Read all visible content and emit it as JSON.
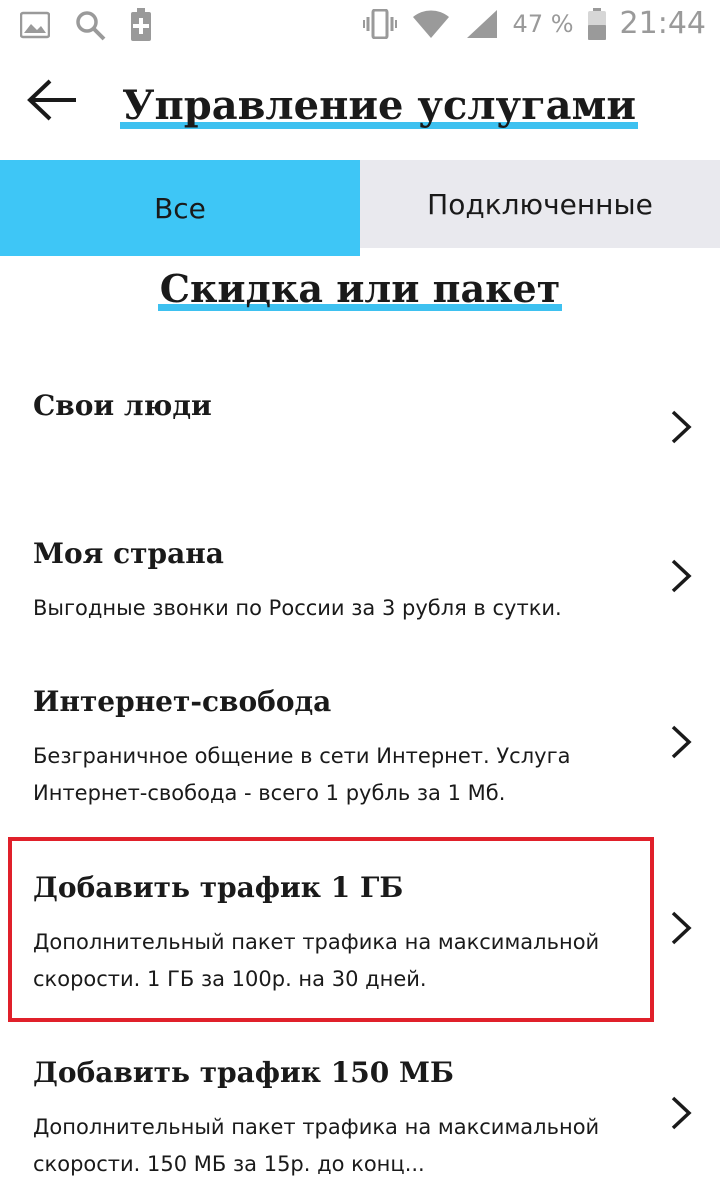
{
  "status_bar": {
    "battery_percent": "47 %",
    "time": "21:44",
    "icons": [
      "image-icon",
      "search-icon",
      "battery-saver-icon",
      "vibrate-icon",
      "wifi-icon",
      "signal-icon",
      "battery-icon"
    ]
  },
  "header": {
    "back_icon": "arrow-left-icon",
    "title": "Управление услугами"
  },
  "tabs": [
    {
      "label": "Все",
      "active": true
    },
    {
      "label": "Подключенные",
      "active": false
    }
  ],
  "section": {
    "title": "Скидка или пакет"
  },
  "items": [
    {
      "title": "Свои люди",
      "description": ""
    },
    {
      "title": "Моя страна",
      "description": "Выгодные звонки по России за 3 рубля в сутки."
    },
    {
      "title": "Интернет-свобода",
      "description": "Безграничное общение в сети Интернет. Услуга Интернет-свобода - всего 1 рубль за 1 Мб."
    },
    {
      "title": "Добавить трафик 1 ГБ",
      "description": "Дополнительный пакет трафика на максимальной скорости. 1 ГБ за 100р. на 30 дней."
    },
    {
      "title": "Добавить трафик 150 МБ",
      "description": "Дополнительный пакет трафика на максимальной скорости. 150 МБ за 15р. до конц..."
    }
  ],
  "colors": {
    "accent": "#3ec6f6",
    "tab_inactive": "#e9e9ee",
    "highlight_border": "#e0202a"
  }
}
